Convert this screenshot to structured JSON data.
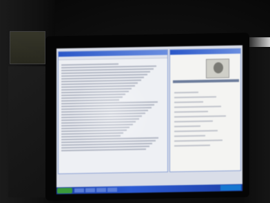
{
  "scene": {
    "type": "photo-of-monitor",
    "monitor_screen": {
      "os_taskbar_color": "#2c5bd4",
      "left_window_lines": 32,
      "right_window_lines": 12
    }
  }
}
